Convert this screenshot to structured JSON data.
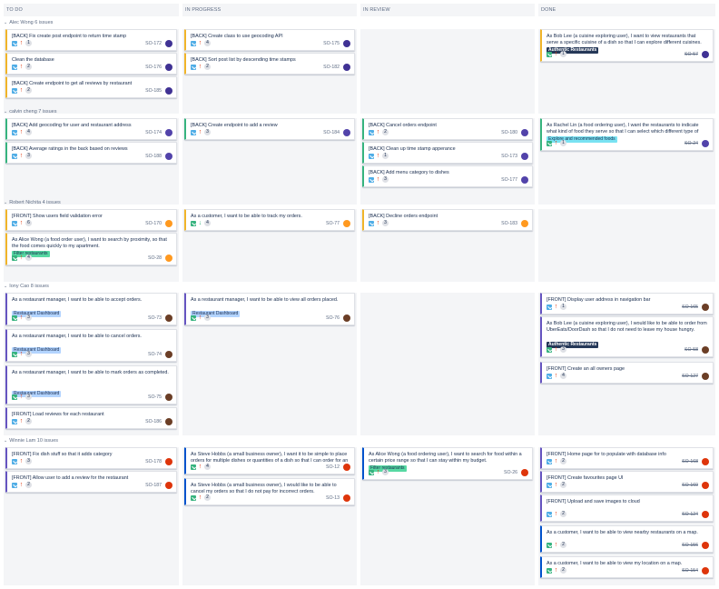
{
  "columns": [
    "TO DO",
    "IN PROGRESS",
    "IN REVIEW",
    "DONE"
  ],
  "swimlanes": [
    {
      "title": "Alec Wong 6 issues",
      "cells": [
        [
          {
            "title": "[BACK] Fix create post endpoint to return time stamp",
            "key": "SO-172",
            "est": "1",
            "type": "story",
            "prio": "high",
            "avatar": "aw",
            "edge": "yellow"
          },
          {
            "title": "Clean the database",
            "key": "SO-176",
            "est": "2",
            "type": "story",
            "prio": "high",
            "avatar": "aw",
            "edge": "yellow"
          },
          {
            "title": "[BACK] Create endpoint to get all reviews by restaurant",
            "key": "SO-185",
            "est": "2",
            "type": "story",
            "prio": "high",
            "avatar": "aw",
            "edge": "yellow"
          }
        ],
        [
          {
            "title": "[BACK] Create class to use geocoding API",
            "key": "SO-175",
            "est": "4",
            "type": "story",
            "prio": "high",
            "avatar": "aw",
            "edge": "yellow"
          },
          {
            "title": "[BACK] Sort post list by descending time stamps",
            "key": "SO-182",
            "est": "2",
            "type": "story",
            "prio": "high",
            "avatar": "aw",
            "edge": "yellow"
          }
        ],
        [],
        [
          {
            "title": "As Bob Lee (a cuisine exploring user), I want to view restaurants that serve a specific cuisine of a dish so that I can explore different cuisines.",
            "badge": "Authentic Restaurants",
            "badgeStyle": "dark",
            "key": "SO-57",
            "est": "1",
            "type": "green",
            "prio": "high",
            "avatar": "aw",
            "edge": "yellow",
            "done": true
          }
        ]
      ]
    },
    {
      "title": "calvin cheng 7 issues",
      "cells": [
        [
          {
            "title": "[BACK] Add geocoding for user and restaurant address",
            "key": "SO-174",
            "est": "4",
            "type": "story",
            "prio": "high",
            "avatar": "cc",
            "edge": "green"
          },
          {
            "title": "[BACK] Average ratings in the back based on reviews",
            "key": "SO-188",
            "est": "3",
            "type": "story",
            "prio": "high",
            "avatar": "cc",
            "edge": "green"
          }
        ],
        [
          {
            "title": "[BACK] Create endpoint to add a review",
            "key": "SO-184",
            "est": "3",
            "type": "story",
            "prio": "high",
            "avatar": "cc",
            "edge": "green"
          }
        ],
        [
          {
            "title": "[BACK] Cancel orders endpoint",
            "key": "SO-180",
            "est": "2",
            "type": "story",
            "prio": "high",
            "avatar": "cc",
            "edge": "green"
          },
          {
            "title": "[BACK] Clean up time stamp apperance",
            "key": "SO-173",
            "est": "1",
            "type": "story",
            "prio": "high",
            "avatar": "cc",
            "edge": "green"
          },
          {
            "title": "[BACK] Add menu category to dishes",
            "key": "SO-177",
            "est": "3",
            "type": "story",
            "prio": "high",
            "avatar": "cc",
            "edge": "green"
          }
        ],
        [
          {
            "title": "As Rachel Lin (a food ordering user), I want the restaurants to indicate what kind of food they serve so that I can select which different type of food to try.",
            "badge": "Explore and recommended foods",
            "badgeStyle": "cyan",
            "key": "SO-24",
            "est": "1",
            "type": "green",
            "prio": "high",
            "avatar": "cc",
            "edge": "green",
            "done": true
          }
        ]
      ]
    },
    {
      "title": "Robert Nichita 4 issues",
      "cells": [
        [
          {
            "title": "[FRONT] Show users field validation error",
            "key": "SO-170",
            "est": "6",
            "type": "story",
            "prio": "high",
            "avatar": "rn",
            "edge": "yellow"
          },
          {
            "title": "As Alice Wong (a food order user), I want to search by proximity, so that the food comes quickly to my apartment.",
            "badge": "Filter restaurants",
            "badgeStyle": "green",
            "key": "SO-28",
            "est": "4",
            "type": "green",
            "prio": "high",
            "avatar": "rn",
            "edge": "yellow"
          }
        ],
        [
          {
            "title": "As a customer, I want to be able to track my orders.",
            "key": "SO-77",
            "est": "4",
            "type": "green",
            "prio": "low",
            "avatar": "rn",
            "edge": "yellow"
          }
        ],
        [
          {
            "title": "[BACK] Decline orders endpoint",
            "key": "SO-183",
            "est": "3",
            "type": "story",
            "prio": "high",
            "avatar": "rn",
            "edge": "yellow"
          }
        ],
        []
      ]
    },
    {
      "title": "Iony Cao 8 issues",
      "cells": [
        [
          {
            "title": "As a restaurant manager, I want to be able to accept orders.",
            "badge": "Restaurant Dashboard",
            "badgeStyle": "blue",
            "key": "SO-73",
            "est": "3",
            "type": "green",
            "prio": "high",
            "avatar": "ic",
            "edge": "purple"
          },
          {
            "title": "As a restaurant manager, I want to be able to cancel orders.",
            "badge": "Restaurant Dashboard",
            "badgeStyle": "blue",
            "key": "SO-74",
            "est": "3",
            "type": "green",
            "prio": "high",
            "avatar": "ic",
            "edge": "purple"
          },
          {
            "title": "As a restaurant manager, I want to be able to mark orders as completed.",
            "badge": "Restaurant Dashboard",
            "badgeStyle": "blue",
            "key": "SO-75",
            "est": "3",
            "type": "green",
            "prio": "high",
            "avatar": "ic",
            "edge": "purple"
          },
          {
            "title": "[FRONT] Load reviews for each restaurant",
            "key": "SO-186",
            "est": "2",
            "type": "story",
            "prio": "high",
            "avatar": "ic",
            "edge": "purple"
          }
        ],
        [
          {
            "title": "As a restaurant manager, I want to be able to view all orders placed.",
            "badge": "Restaurant Dashboard",
            "badgeStyle": "blue",
            "key": "SO-76",
            "est": "3",
            "type": "green",
            "prio": "high",
            "avatar": "ic",
            "edge": "purple"
          }
        ],
        [],
        [
          {
            "title": "[FRONT] Display user address in navigation bar",
            "key": "SO-165",
            "est": "1",
            "type": "story",
            "prio": "high",
            "avatar": "ic",
            "edge": "purple",
            "done": true
          },
          {
            "title": "As Bob Lee (a cuisine exploring user), I would like to be able to order from UberEats/DoorDash so that I do not need to leave my house hungry.",
            "badge": "Authentic Restaurants",
            "badgeStyle": "dark",
            "key": "SO-58",
            "est": "3",
            "type": "green",
            "prio": "high",
            "avatar": "ic",
            "edge": "purple",
            "done": true
          },
          {
            "title": "[FRONT] Create an all owners page",
            "key": "SO-127",
            "est": "4",
            "type": "story",
            "prio": "high",
            "avatar": "ic",
            "edge": "purple",
            "done": true
          }
        ]
      ]
    },
    {
      "title": "Winnie Lam 10 issues",
      "cells": [
        [
          {
            "title": "[FRONT] Fix dish stuff so that it adds category",
            "key": "SO-178",
            "est": "3",
            "type": "story",
            "prio": "high",
            "avatar": "wl",
            "edge": "purple"
          },
          {
            "title": "[FRONT] Allow user to add a review for the restaurant",
            "key": "SO-187",
            "est": "2",
            "type": "story",
            "prio": "high",
            "avatar": "wl",
            "edge": "purple"
          }
        ],
        [
          {
            "title": "As Steve Hobbs (a small business owner), I want it to be simple to place orders for multiple dishes or quantities of a dish so that I can order for an entire group of people.",
            "key": "SO-12",
            "est": "4",
            "type": "green",
            "prio": "high",
            "avatar": "wl",
            "edge": "blue"
          },
          {
            "title": "As Steve Hobbs (a small business owner), I would like to be able to cancel my orders so that I do not pay for incorrect orders.",
            "key": "SO-13",
            "est": "2",
            "type": "green",
            "prio": "high",
            "avatar": "wl",
            "edge": "blue"
          }
        ],
        [
          {
            "title": "As Alice Wong (a food ordering user), I want to search for food within a certain price range so that I can stay within my budget.",
            "badge": "Filter restaurants",
            "badgeStyle": "green",
            "key": "SO-26",
            "est": "3",
            "type": "green",
            "prio": "high",
            "avatar": "wl",
            "edge": "blue"
          }
        ],
        [
          {
            "title": "[FRONT] Home page for to populate with database info",
            "key": "SO-168",
            "est": "2",
            "type": "story",
            "prio": "high",
            "avatar": "wl",
            "edge": "purple",
            "done": true
          },
          {
            "title": "[FRONT] Create favourites page UI",
            "key": "SO-169",
            "est": "2",
            "type": "story",
            "prio": "high",
            "avatar": "wl",
            "edge": "purple",
            "done": true
          },
          {
            "title": "[FRONT] Upload and save images to cloud",
            "key": "SO-124",
            "est": "2",
            "type": "story",
            "prio": "high",
            "avatar": "wl",
            "edge": "purple",
            "done": true
          },
          {
            "title": "As a customer, I want to be able to view nearby restaurants on a map.",
            "key": "SO-156",
            "est": "2",
            "type": "green",
            "prio": "high",
            "avatar": "wl",
            "edge": "blue",
            "done": true
          },
          {
            "title": "As a customer, I want to be able to view my location on a map.",
            "key": "SO-154",
            "est": "2",
            "type": "green",
            "prio": "high",
            "avatar": "wl",
            "edge": "blue",
            "done": true
          }
        ]
      ]
    }
  ],
  "colors": {
    "badge_dark": "#253858",
    "badge_cyan": "#79e2f2",
    "badge_green": "#57d9a3",
    "badge_blue": "#b3d4ff"
  }
}
